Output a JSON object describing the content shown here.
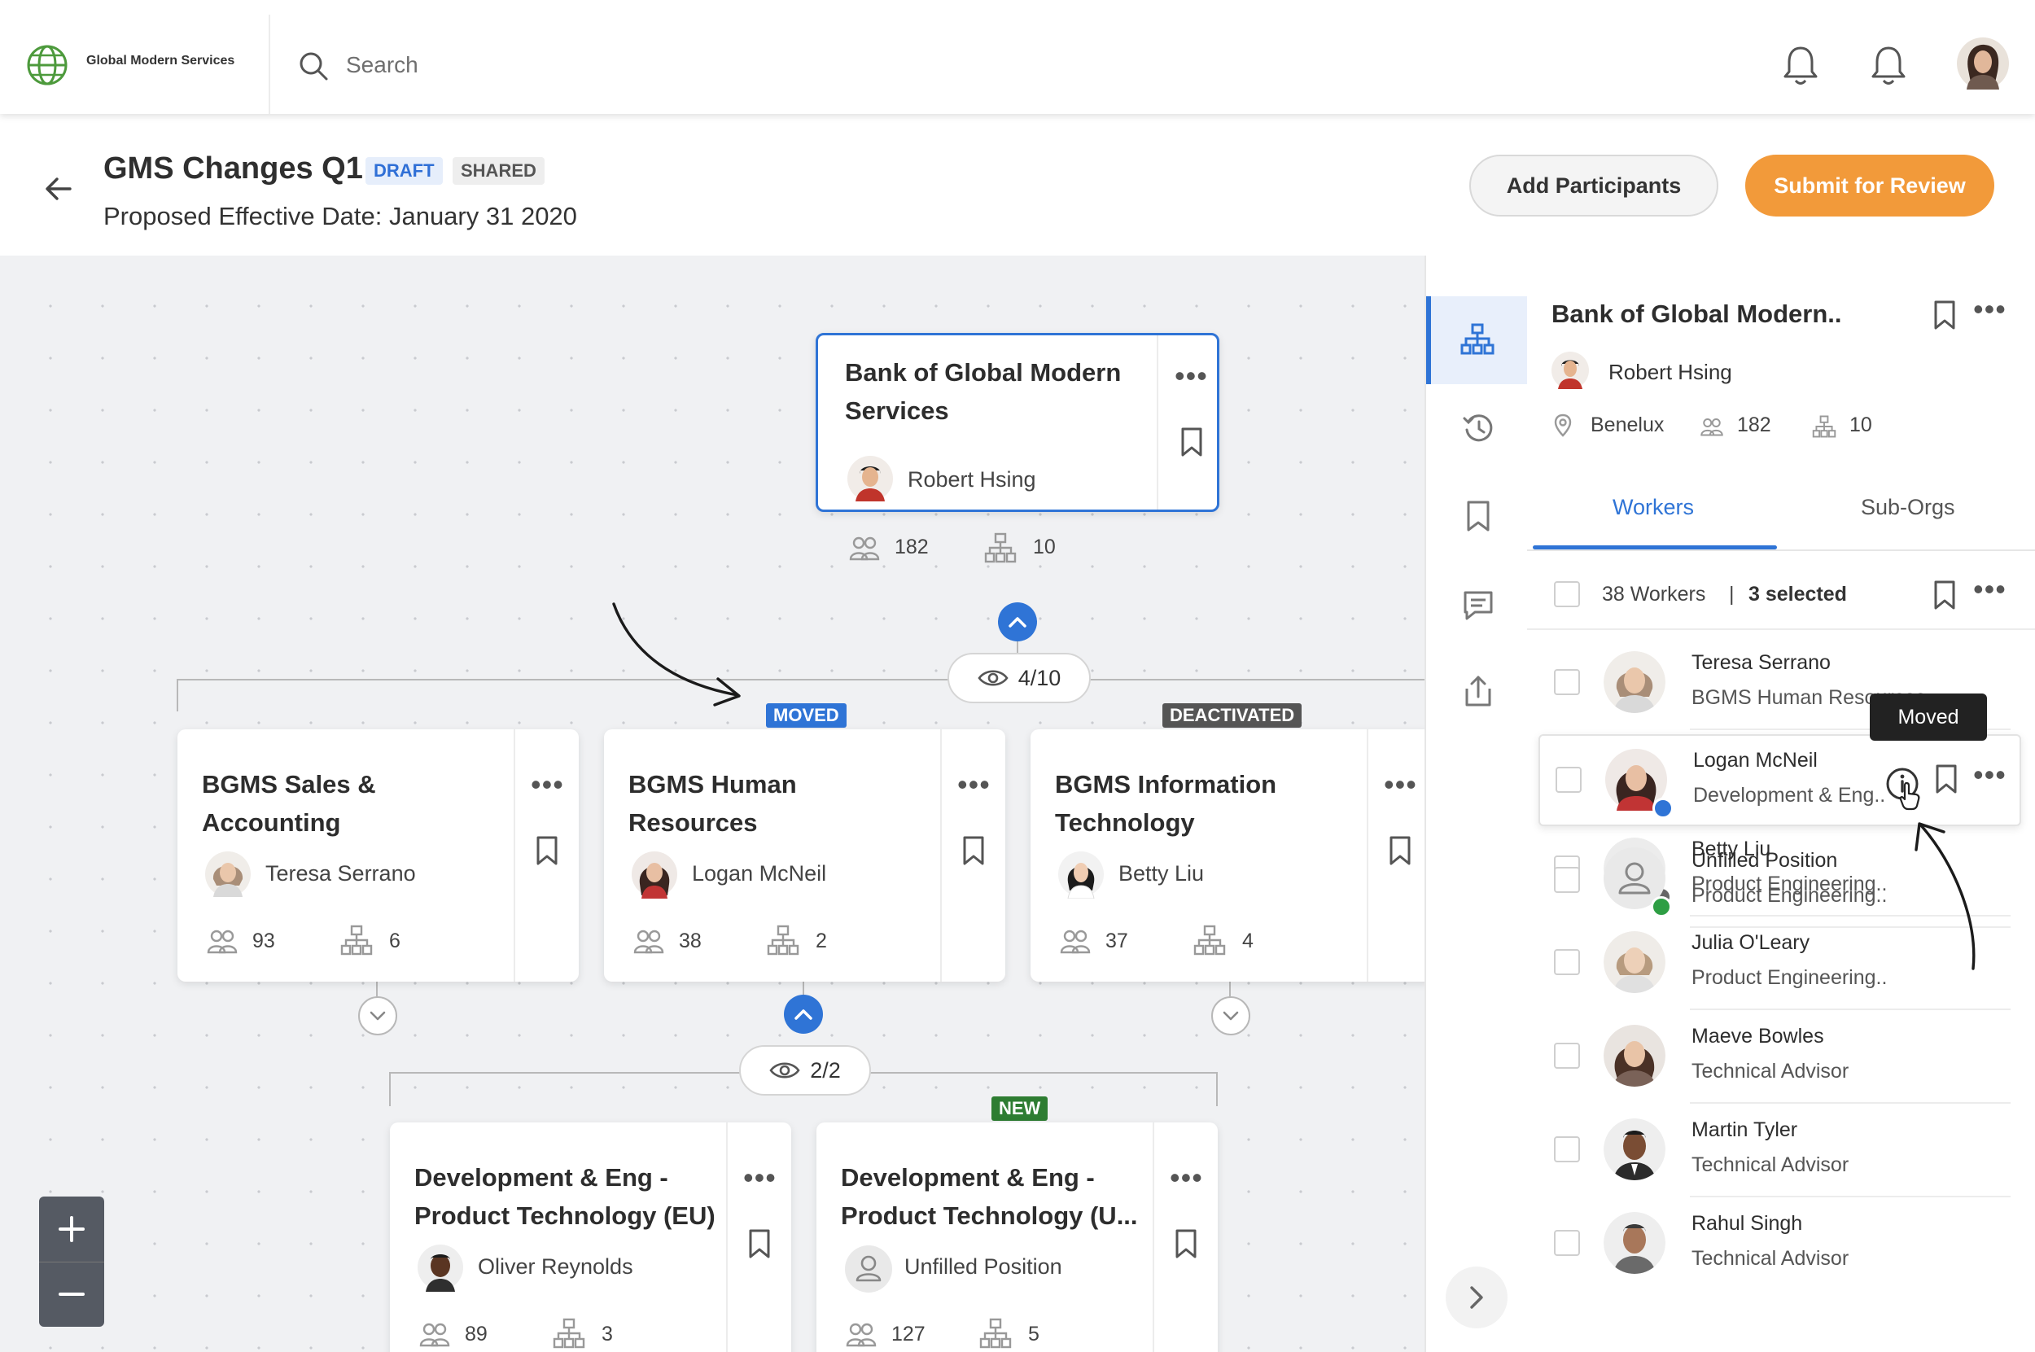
{
  "app": {
    "logo_text": "Global Modern Services",
    "search_placeholder": "Search"
  },
  "header": {
    "title": "GMS Changes Q1",
    "badge_draft": "DRAFT",
    "badge_shared": "SHARED",
    "effective_date": "Proposed Effective Date:  January 31 2020",
    "add_participants": "Add Participants",
    "submit_for_review": "Submit for Review"
  },
  "colors": {
    "accent_blue": "#2f74d6",
    "submit_orange": "#f29a3a",
    "moved_tag": "#2f74d6",
    "deactivated_tag": "#555555",
    "new_tag": "#2e7d32"
  },
  "org": {
    "root": {
      "title_line1": "Bank of Global Modern",
      "title_line2": "Services",
      "manager": "Robert Hsing",
      "workers": "182",
      "suborgs": "10"
    },
    "pill_level1": "4/10",
    "pill_level2": "2/2",
    "tag_moved": "MOVED",
    "tag_deactivated": "DEACTIVATED",
    "tag_new": "NEW",
    "cards": [
      {
        "title_line1": "BGMS Sales &",
        "title_line2": "Accounting",
        "manager": "Teresa Serrano",
        "workers": "93",
        "suborgs": "6"
      },
      {
        "title_line1": "BGMS Human",
        "title_line2": "Resources",
        "manager": "Logan McNeil",
        "workers": "38",
        "suborgs": "2"
      },
      {
        "title_line1": "BGMS Information",
        "title_line2": "Technology",
        "manager": "Betty Liu",
        "workers": "37",
        "suborgs": "4"
      },
      {
        "title_line1": "Development & Eng -",
        "title_line2": "Product Technology (EU)",
        "manager": "Oliver Reynolds",
        "workers": "89",
        "suborgs": "3"
      },
      {
        "title_line1": "Development & Eng -",
        "title_line2": "Product Technology (U...",
        "manager": "Unfilled Position",
        "workers": "127",
        "suborgs": "5"
      }
    ]
  },
  "panel": {
    "title": "Bank of Global Modern..",
    "manager": "Robert Hsing",
    "location": "Benelux",
    "workers": "182",
    "suborgs": "10",
    "tab_workers": "Workers",
    "tab_suborgs": "Sub-Orgs",
    "worker_count": "38 Workers",
    "separator": "|",
    "selected": "3 selected",
    "tooltip": "Moved",
    "workers_list": [
      {
        "name": "Teresa Serrano",
        "sub": "BGMS Human Resources"
      },
      {
        "name": "Logan McNeil",
        "sub": "Development & Eng.."
      },
      {
        "name": "Unfilled Position",
        "sub": "Product Engineering.."
      },
      {
        "name": "Betty Liu",
        "sub": "Product Engineering.."
      },
      {
        "name": "Julia O'Leary",
        "sub": "Product Engineering.."
      },
      {
        "name": "Maeve Bowles",
        "sub": "Technical Advisor"
      },
      {
        "name": "Martin Tyler",
        "sub": "Technical Advisor"
      },
      {
        "name": "Rahul Singh",
        "sub": "Technical Advisor"
      }
    ]
  }
}
